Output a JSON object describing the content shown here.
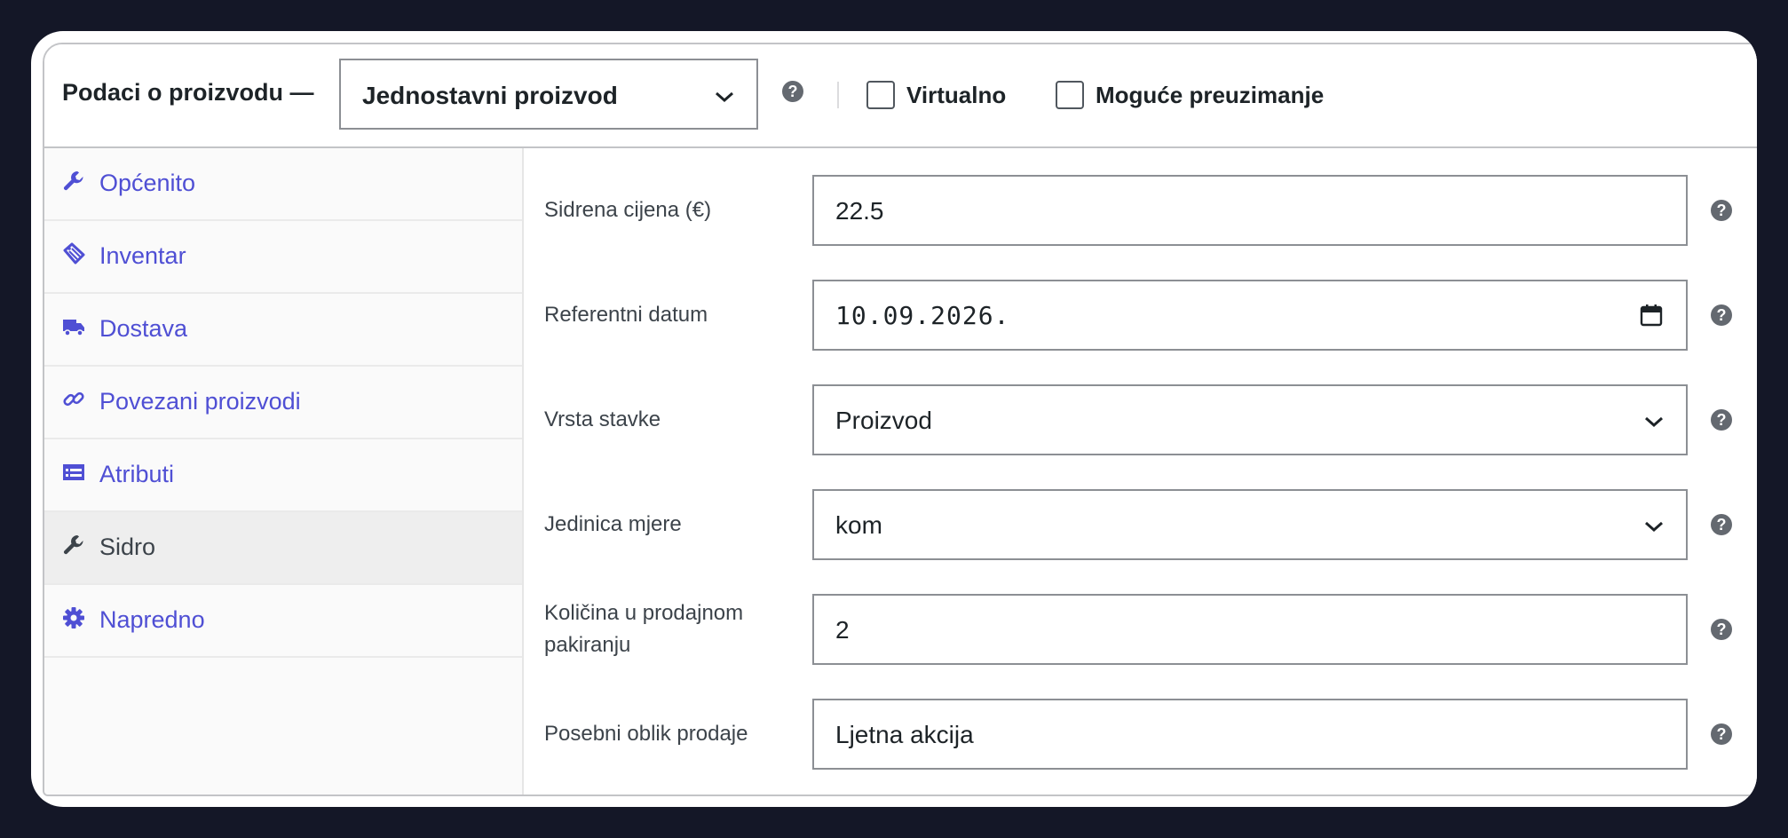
{
  "header": {
    "title": "Podaci o proizvodu —",
    "product_type": "Jednostavni proizvod",
    "checkboxes": [
      {
        "label": "Virtualno",
        "checked": false
      },
      {
        "label": "Moguće preuzimanje",
        "checked": false
      }
    ]
  },
  "sidebar": {
    "active": "Sidro",
    "tabs": [
      {
        "label": "Općenito",
        "icon": "wrench-icon"
      },
      {
        "label": "Inventar",
        "icon": "tag-icon"
      },
      {
        "label": "Dostava",
        "icon": "truck-icon"
      },
      {
        "label": "Povezani proizvodi",
        "icon": "link-icon"
      },
      {
        "label": "Atributi",
        "icon": "list-icon"
      },
      {
        "label": "Sidro",
        "icon": "wrench-icon"
      },
      {
        "label": "Napredno",
        "icon": "gear-icon"
      }
    ]
  },
  "fields": [
    {
      "label": "Sidrena cijena (€)",
      "value": "22.5",
      "type": "text"
    },
    {
      "label": "Referentni datum",
      "value": "10.09.2026.",
      "type": "date"
    },
    {
      "label": "Vrsta stavke",
      "value": "Proizvod",
      "type": "select"
    },
    {
      "label": "Jedinica mjere",
      "value": "kom",
      "type": "select"
    },
    {
      "label": "Količina u prodajnom pakiranju",
      "value": "2",
      "type": "text"
    },
    {
      "label": "Posebni oblik prodaje",
      "value": "Ljetna akcija",
      "type": "text"
    }
  ],
  "help_glyph": "?",
  "colors": {
    "background": "#141727",
    "link": "#4f4fd4",
    "active_tab_bg": "#eeeeee",
    "border": "#8c8f94",
    "help_icon": "#646970"
  }
}
